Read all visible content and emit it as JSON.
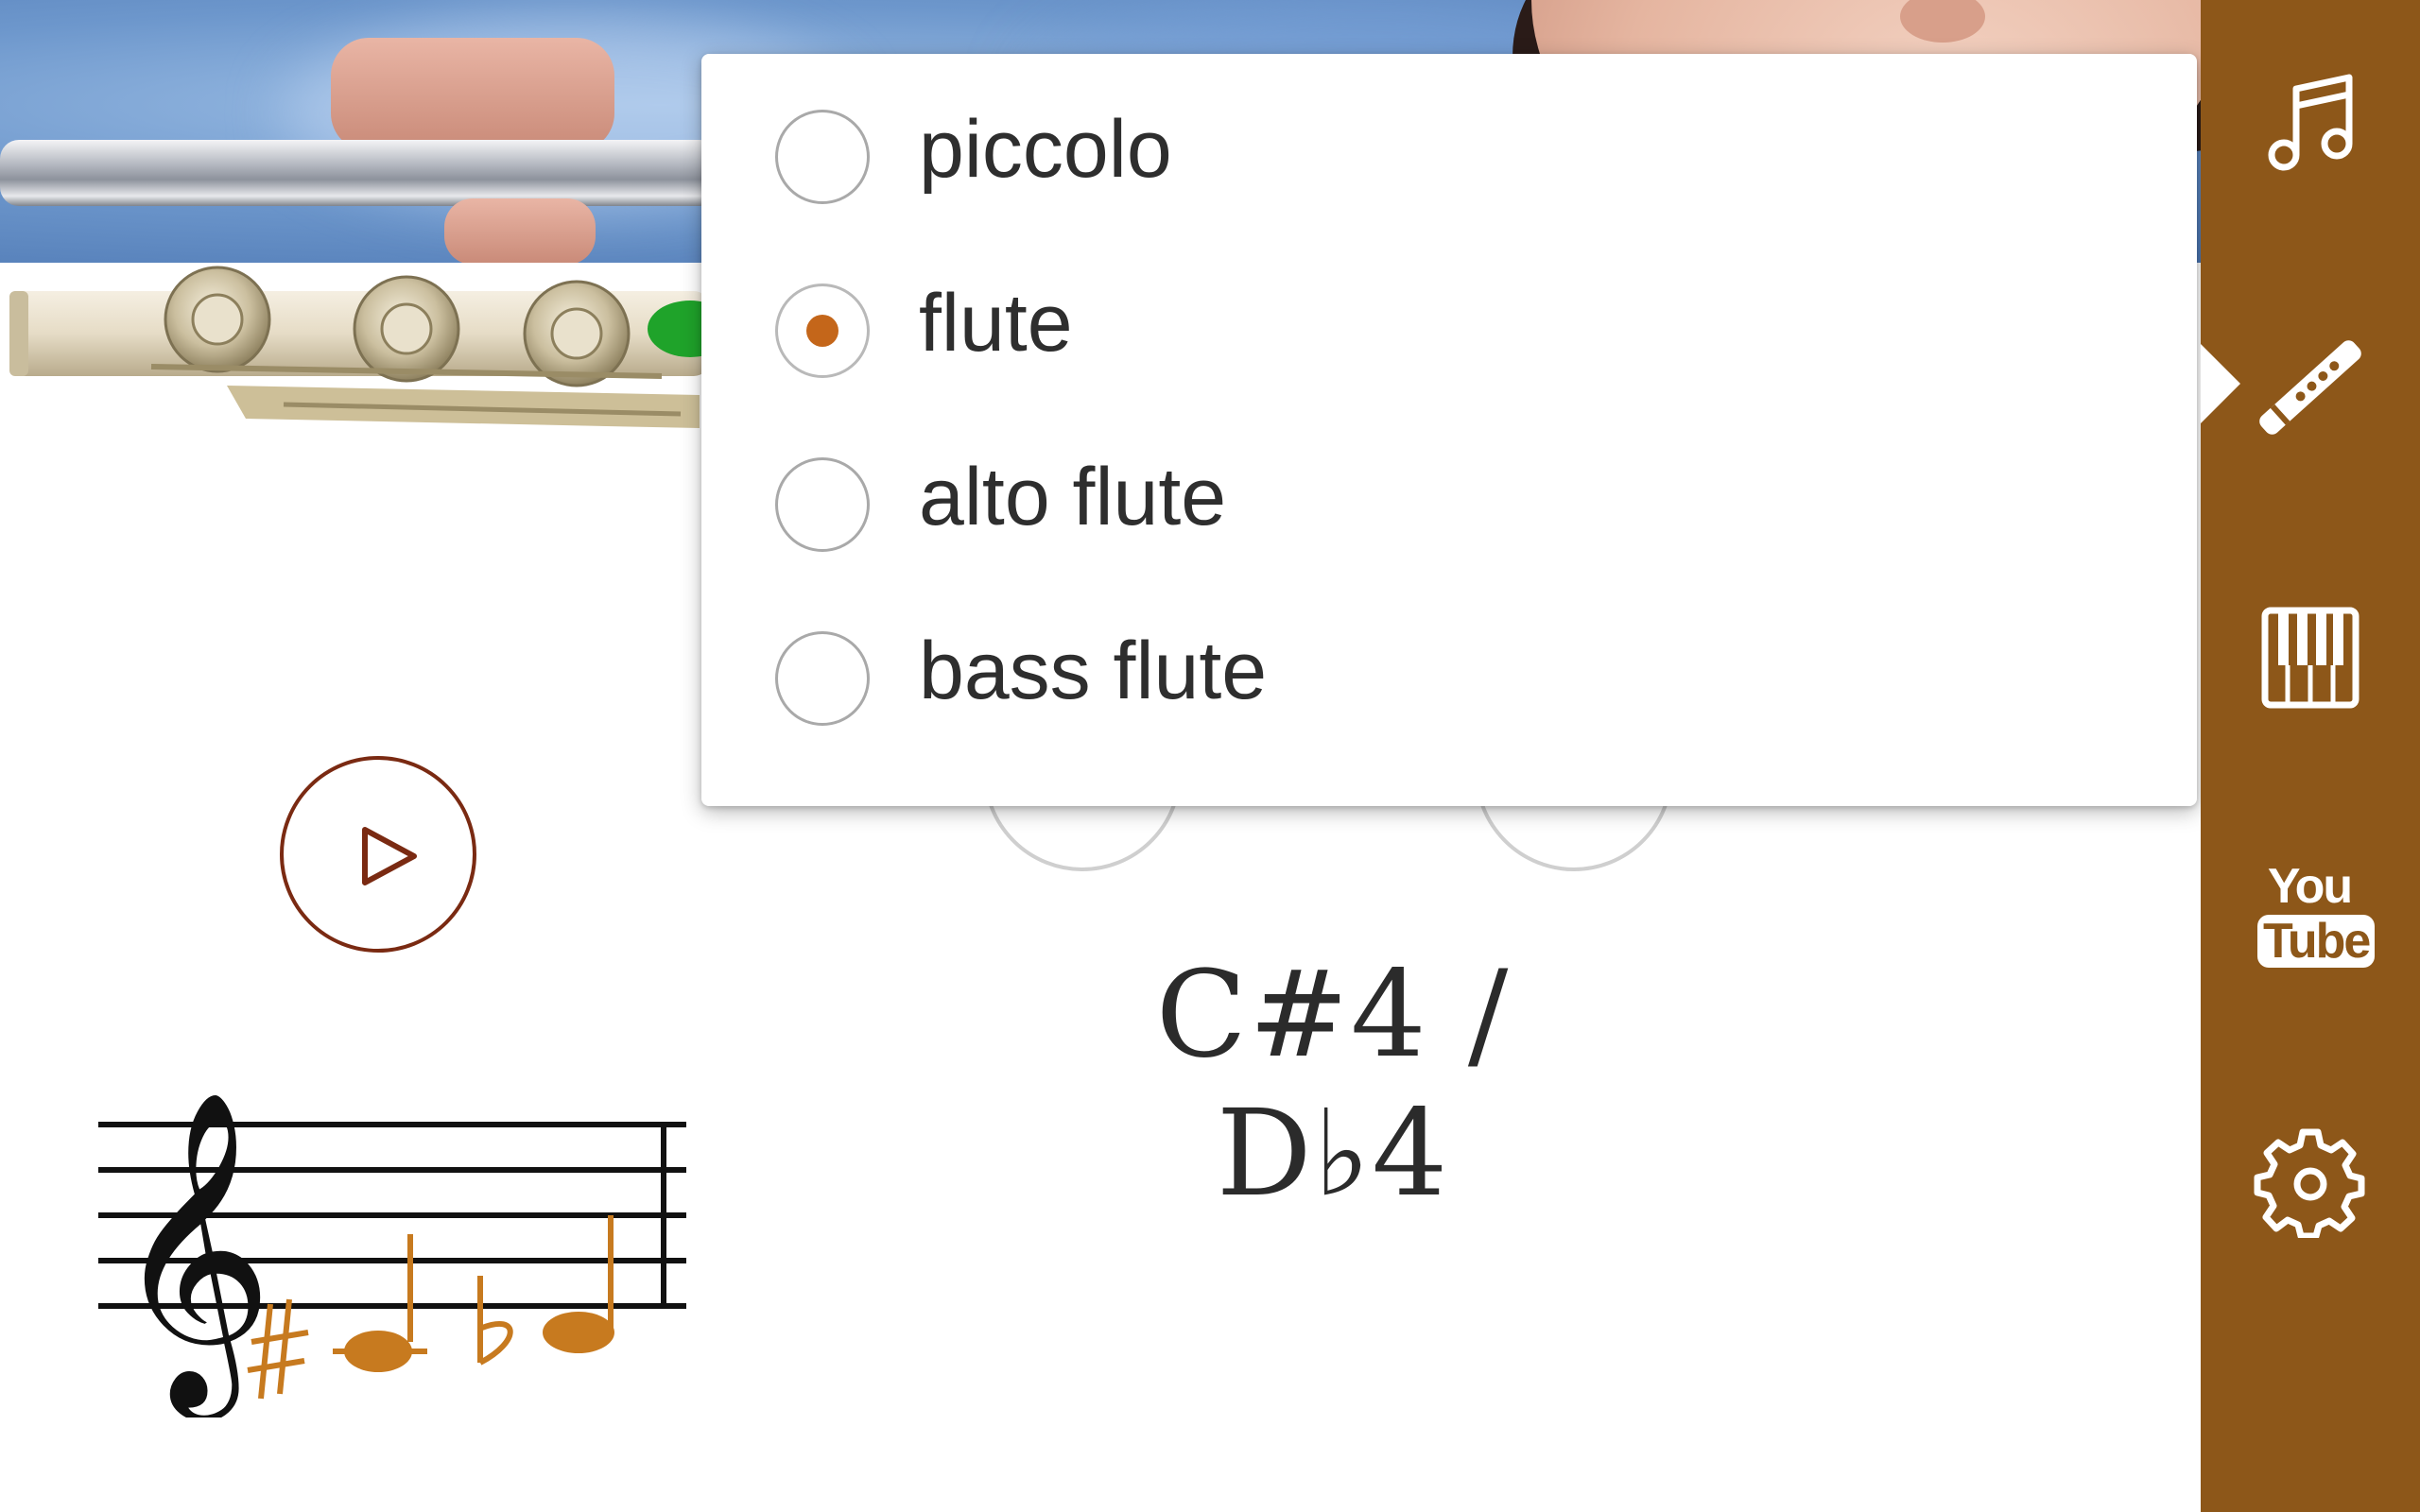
{
  "instrument_menu": {
    "options": [
      {
        "label": "piccolo",
        "selected": false
      },
      {
        "label": "flute",
        "selected": true
      },
      {
        "label": "alto flute",
        "selected": false
      },
      {
        "label": "bass flute",
        "selected": false
      }
    ]
  },
  "note": {
    "name": "C#4 / D♭4"
  },
  "toolbar": {
    "items": [
      {
        "icon": "music-note-icon",
        "active": false
      },
      {
        "icon": "flute-icon",
        "active": true
      },
      {
        "icon": "piano-keyboard-icon",
        "active": false
      },
      {
        "icon": "youtube-icon",
        "active": false,
        "text_top": "You",
        "text_bottom": "Tube"
      },
      {
        "icon": "gear-icon",
        "active": false
      }
    ]
  },
  "colors": {
    "toolbar_bg": "#8d5719",
    "accent": "#c4661a",
    "play_border": "#7a2a12",
    "note_color": "#c77a1f"
  }
}
